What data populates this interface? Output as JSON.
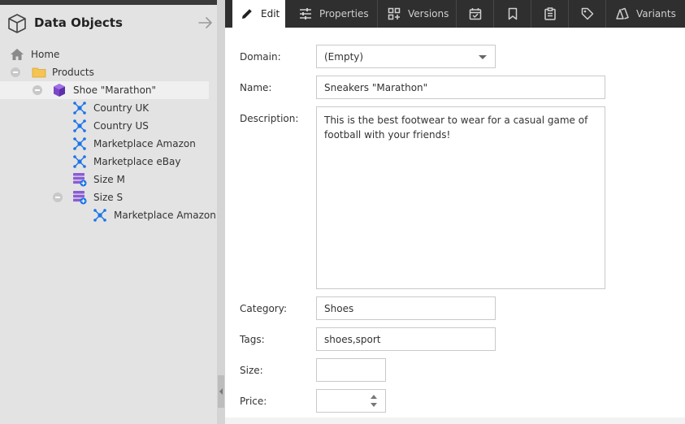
{
  "sidebar": {
    "title": "Data Objects",
    "tree": [
      {
        "label": "Home",
        "icon": "home-icon"
      },
      {
        "label": "Products",
        "icon": "folder-icon"
      },
      {
        "label": "Shoe \"Marathon\"",
        "icon": "product-cube-icon"
      },
      {
        "label": "Country UK",
        "icon": "variant-hub-icon"
      },
      {
        "label": "Country US",
        "icon": "variant-hub-icon"
      },
      {
        "label": "Marketplace Amazon",
        "icon": "variant-hub-icon"
      },
      {
        "label": "Marketplace eBay",
        "icon": "variant-hub-icon"
      },
      {
        "label": "Size M",
        "icon": "server-stack-icon"
      },
      {
        "label": "Size S",
        "icon": "server-stack-icon"
      },
      {
        "label": "Marketplace Amazon",
        "icon": "variant-hub-icon"
      }
    ]
  },
  "tabs": [
    {
      "label": "Edit",
      "icon": "pencil-icon"
    },
    {
      "label": "Properties",
      "icon": "sliders-icon"
    },
    {
      "label": "Versions",
      "icon": "versions-grid-icon"
    },
    {
      "label": "",
      "icon": "calendar-check-icon"
    },
    {
      "label": "",
      "icon": "bookmark-icon"
    },
    {
      "label": "",
      "icon": "clipboard-icon"
    },
    {
      "label": "",
      "icon": "tag-icon"
    },
    {
      "label": "Variants",
      "icon": "variants-icon"
    }
  ],
  "form": {
    "domain": {
      "label": "Domain:",
      "value": "(Empty)"
    },
    "name": {
      "label": "Name:",
      "value": "Sneakers \"Marathon\""
    },
    "description": {
      "label": "Description:",
      "value": "This is the best footwear to wear for a casual game of football with your friends!"
    },
    "category": {
      "label": "Category:",
      "value": "Shoes"
    },
    "tags": {
      "label": "Tags:",
      "value": "shoes,sport"
    },
    "size": {
      "label": "Size:",
      "value": ""
    },
    "price": {
      "label": "Price:",
      "value": ""
    }
  },
  "colors": {
    "accent_blue": "#1a73e8",
    "product_purple": "#7b47c7",
    "folder_yellow": "#f5c451",
    "tab_bar": "#2f2f2f"
  }
}
